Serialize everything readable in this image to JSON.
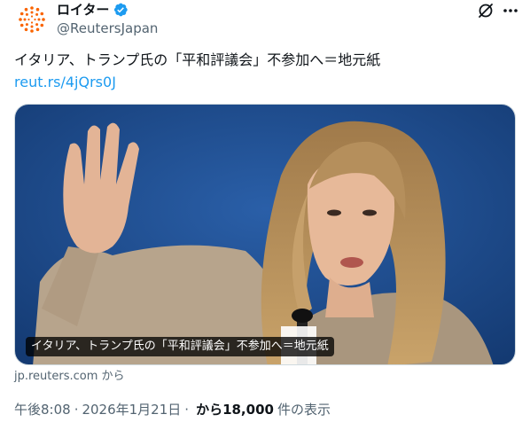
{
  "author": {
    "display_name": "ロイター",
    "handle": "@ReutersJapan"
  },
  "tweet": {
    "text": "イタリア、トランプ氏の「平和評議会」不参加へ＝地元紙",
    "link_text": "reut.rs/4jQrs0J"
  },
  "card": {
    "caption": "イタリア、トランプ氏の「平和評議会」不参加へ＝地元紙",
    "source": "jp.reuters.com から"
  },
  "meta": {
    "time": "午後8:08",
    "separator": "·",
    "date": "2026年1月21日",
    "separator2": "·",
    "views_count": "から18,000",
    "views_label": "件の表示"
  },
  "icons": {
    "avatar": "reuters-logo-icon",
    "verified": "verified-badge-icon",
    "grok": "grok-icon",
    "more": "more-horizontal-icon"
  },
  "colors": {
    "text_primary": "#0f1419",
    "text_secondary": "#536471",
    "link": "#1d9bf0",
    "verified": "#1d9bf0",
    "reuters_orange": "#fa6400",
    "photo_background": "#1b4a8a"
  }
}
